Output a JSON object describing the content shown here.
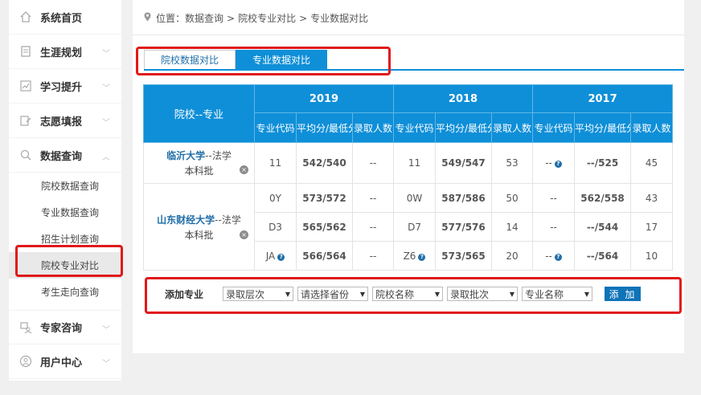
{
  "sidebar": {
    "items": [
      {
        "label": "系统首页",
        "icon": "home-icon"
      },
      {
        "label": "生涯规划",
        "icon": "book-icon"
      },
      {
        "label": "学习提升",
        "icon": "chart-icon"
      },
      {
        "label": "志愿填报",
        "icon": "edit-icon"
      },
      {
        "label": "数据查询",
        "icon": "magnifier-icon"
      }
    ],
    "sub_items": [
      "院校数据查询",
      "专业数据查询",
      "招生计划查询",
      "院校专业对比",
      "考生走向查询"
    ],
    "bottom_items": [
      {
        "label": "专家咨询",
        "icon": "expert-icon"
      },
      {
        "label": "用户中心",
        "icon": "user-icon"
      }
    ]
  },
  "breadcrumb": {
    "location": "位置：",
    "p1": "数据查询",
    "sep": ">",
    "p2": "院校专业对比",
    "p3": "专业数据对比"
  },
  "tabs": [
    "院校数据对比",
    "专业数据对比"
  ],
  "table": {
    "head_label": "院校--专业",
    "years": [
      "2019",
      "2018",
      "2017"
    ],
    "sub_headers": [
      "专业代码",
      "平均分/最低分",
      "录取人数"
    ],
    "rows": [
      {
        "school": "临沂大学",
        "major": "--法学",
        "batch": "本科批",
        "cells": [
          "11",
          "542/540",
          "--",
          "11",
          "549/547",
          "53",
          "--",
          "--/525",
          "45"
        ]
      },
      {
        "school": "山东财经大学",
        "major": "--法学",
        "batch": "本科批",
        "cells": [
          "0Y",
          "573/572",
          "--",
          "0W",
          "587/586",
          "50",
          "--",
          "562/558",
          "43"
        ]
      },
      {
        "cells": [
          "D3",
          "565/562",
          "--",
          "D7",
          "577/576",
          "14",
          "--",
          "--/544",
          "17"
        ]
      },
      {
        "cells": [
          "JA",
          "566/564",
          "--",
          "Z6",
          "573/565",
          "20",
          "--",
          "--/564",
          "10"
        ]
      }
    ]
  },
  "add": {
    "label": "添加专业",
    "selects": [
      "录取层次",
      "请选择省份",
      "院校名称",
      "录取批次",
      "专业名称"
    ],
    "button": "添 加"
  },
  "colors": {
    "accent": "#0f8fd8",
    "score": "#f08a1e",
    "highlight": "#e0191a"
  }
}
